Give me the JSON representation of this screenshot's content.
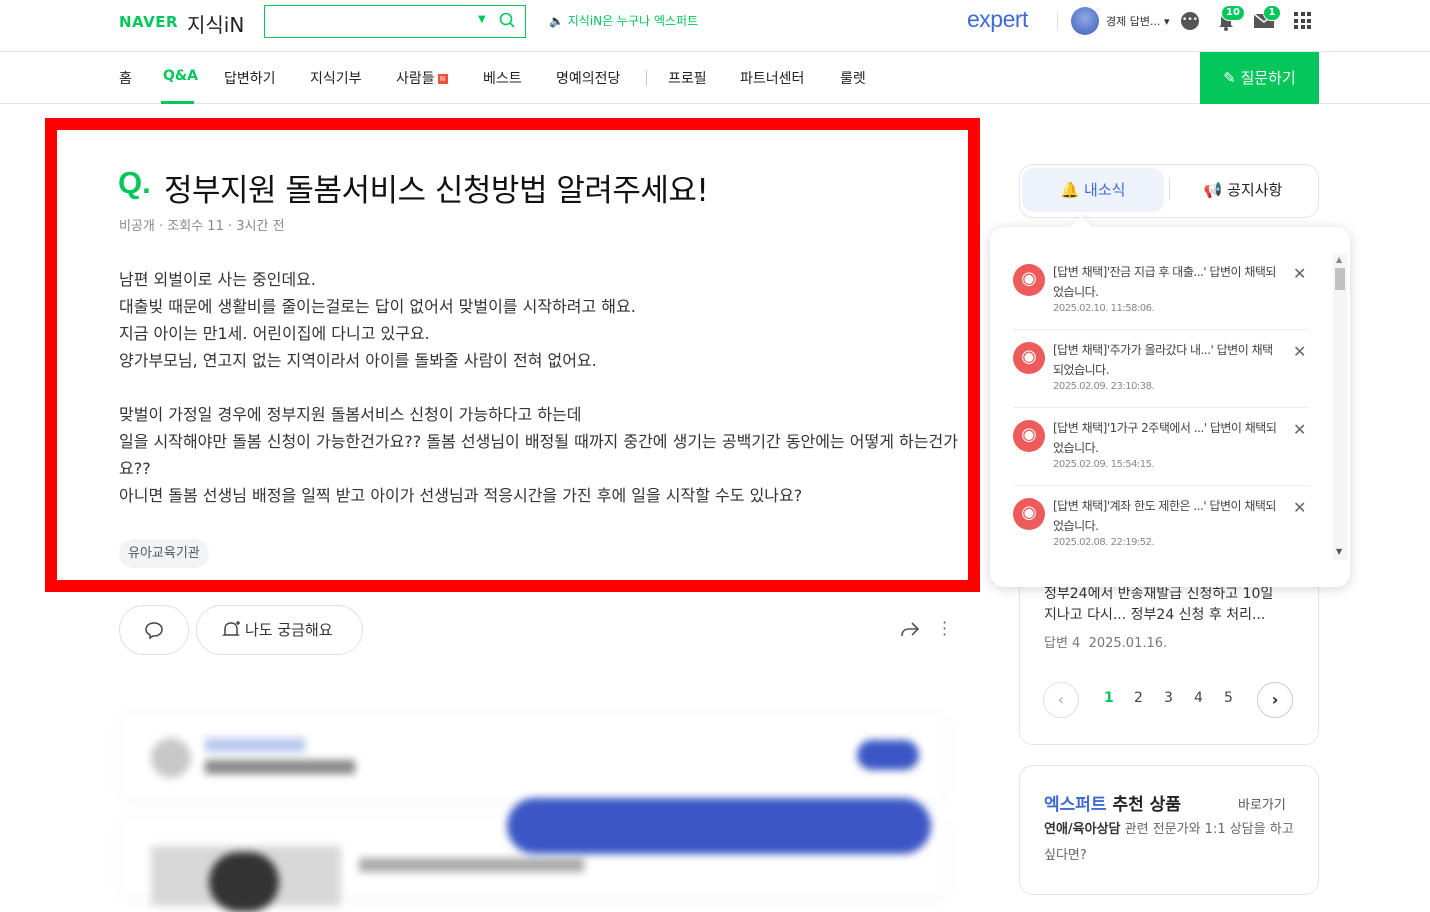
{
  "header": {
    "logo_naver": "NAVER",
    "logo_jisikin": "지식iN",
    "search_placeholder": "",
    "notice_text": "지식iN은 누구나 엑스퍼트",
    "expert_logo": "expert",
    "user_label": "경제 답변...",
    "notification_count": "10",
    "mail_count": "1"
  },
  "nav": {
    "items": [
      "홈",
      "Q&A",
      "답변하기",
      "지식기부",
      "사람들",
      "베스트",
      "명예의전당",
      "프로필",
      "파트너센터",
      "룰렛"
    ],
    "new_badge": "N",
    "active": "Q&A",
    "ask_button": "질문하기"
  },
  "question": {
    "q_mark": "Q.",
    "title": "정부지원 돌봄서비스 신청방법 알려주세요!",
    "author": "비공개",
    "views": "조회수 11",
    "time": "3시간 전",
    "body": [
      "남편 외벌이로 사는 중인데요.",
      "대출빚 때문에 생활비를 줄이는걸로는 답이 없어서 맞벌이를 시작하려고 해요.",
      "지금 아이는 만1세. 어린이집에 다니고 있구요.",
      "양가부모님, 연고지 없는 지역이라서 아이를 돌봐줄 사람이 전혀 없어요.",
      "",
      "맞벌이 가정일 경우에 정부지원 돌봄서비스 신청이 가능하다고 하는데",
      "일을 시작해야만 돌봄 신청이 가능한건가요?? 돌봄 선생님이 배정될 때까지 중간에 생기는 공백기간 동안에는 어떻게 하는건가요??",
      "아니면 돌봄 선생님 배정을 일찍 받고 아이가 선생님과 적응시간을 가진 후에 일을 시작할 수도 있나요?"
    ],
    "tag": "유아교육기관",
    "curious_button": "나도 궁금해요"
  },
  "sidebar": {
    "tab_mynews": "내소식",
    "tab_notice": "공지사항",
    "qa_line1": "정부24에서 반송재발급 신청하고 10일",
    "qa_line2": "지나고 다시... 정부24 신청 후 처리...",
    "qa_answers": "답변 4",
    "qa_date": "2025.01.16.",
    "pages": [
      "1",
      "2",
      "3",
      "4",
      "5"
    ],
    "active_page": "1",
    "product_title_accent": "엑스퍼트",
    "product_title_rest": " 추천 상품",
    "product_link": "바로가기",
    "product_desc_bold": "연애/육아상담",
    "product_desc_rest": " 관련 전문가와 1:1 상담을 하고 싶다면?"
  },
  "notifications": [
    {
      "text": "[답변 채택]'잔금 지급 후 대출...' 답변이 채택되었습니다.",
      "date": "2025.02.10. 11:58:06."
    },
    {
      "text": "[답변 채택]'주가가 올라갔다 내...' 답변이 채택되었습니다.",
      "date": "2025.02.09. 23:10:38."
    },
    {
      "text": "[답변 채택]'1가구 2주택에서 ...' 답변이 채택되었습니다.",
      "date": "2025.02.09. 15:54:15."
    },
    {
      "text": "[답변 채택]'계좌 한도 제한은 ...' 답변이 채택되었습니다.",
      "date": "2025.02.08. 22:19:52."
    }
  ],
  "colors": {
    "brand_green": "#03c75a",
    "expert_blue": "#3f6ad8",
    "highlight_red": "#ff0000",
    "notif_red": "#ee5b5b"
  }
}
